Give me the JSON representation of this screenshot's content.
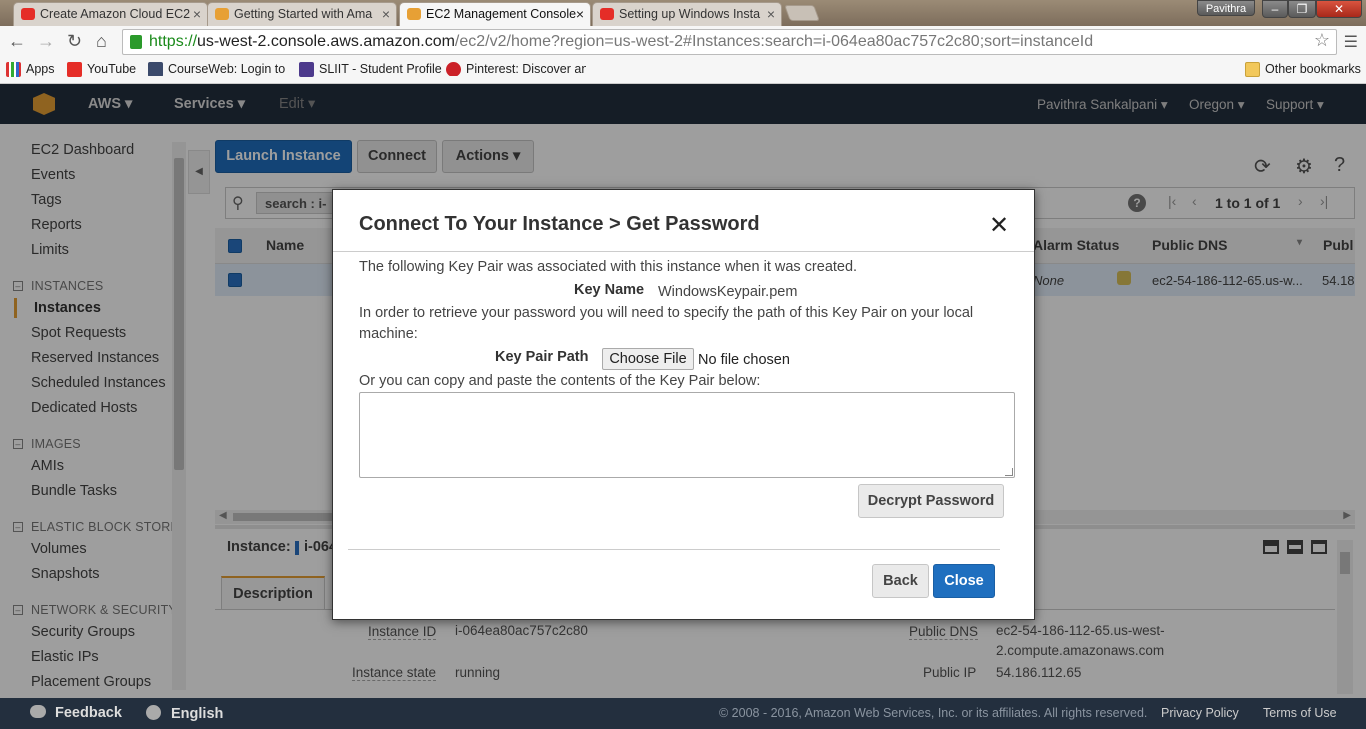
{
  "browser": {
    "tabs": [
      {
        "title": "Create Amazon Cloud EC2",
        "favicon": "youtube-red"
      },
      {
        "title": "Getting Started with Ama",
        "favicon": "aws-orange"
      },
      {
        "title": "EC2 Management Console",
        "favicon": "aws-orange"
      },
      {
        "title": "Setting up Windows Insta",
        "favicon": "youtube-red"
      }
    ],
    "user_badge": "Pavithra",
    "url": {
      "scheme": "https://",
      "host": "us-west-2.console.aws.amazon.com",
      "path": "/ec2/v2/home?region=us-west-2#Instances:search=i-064ea80ac757c2c80;sort=instanceId"
    },
    "bookmarks": [
      {
        "label": "Apps"
      },
      {
        "label": "YouTube"
      },
      {
        "label": "CourseWeb: Login to"
      },
      {
        "label": "SLIIT - Student Profile"
      },
      {
        "label": "Pinterest: Discover an"
      }
    ],
    "other_bookmarks": "Other bookmarks"
  },
  "aws_header": {
    "brand": "AWS",
    "services": "Services",
    "edit": "Edit",
    "user": "Pavithra Sankalpani",
    "region": "Oregon",
    "support": "Support"
  },
  "sidebar": {
    "top_links": [
      "EC2 Dashboard",
      "Events",
      "Tags",
      "Reports",
      "Limits"
    ],
    "sections": [
      {
        "title": "INSTANCES",
        "items": [
          "Instances",
          "Spot Requests",
          "Reserved Instances",
          "Scheduled Instances",
          "Dedicated Hosts"
        ]
      },
      {
        "title": "IMAGES",
        "items": [
          "AMIs",
          "Bundle Tasks"
        ]
      },
      {
        "title": "ELASTIC BLOCK STORE",
        "items": [
          "Volumes",
          "Snapshots"
        ]
      },
      {
        "title": "NETWORK & SECURITY",
        "items": [
          "Security Groups",
          "Elastic IPs",
          "Placement Groups"
        ]
      }
    ],
    "active_item": "Instances"
  },
  "main": {
    "launch_button": "Launch Instance",
    "connect_button": "Connect",
    "actions_button": "Actions",
    "search_token": "search",
    "search_token_value": "i-",
    "pagination": "1 to 1 of 1",
    "columns": {
      "name": "Name",
      "alarm_status": "Alarm Status",
      "public_dns": "Public DNS",
      "public_ip": "Publ"
    },
    "row": {
      "alarm_status": "None",
      "public_dns": "ec2-54-186-112-65.us-w...",
      "public_ip": "54.18"
    },
    "detail_label": "Instance:",
    "detail_value": "i-064",
    "description_tab": "Description",
    "details": {
      "instance_id_label": "Instance ID",
      "instance_id": "i-064ea80ac757c2c80",
      "instance_state_label": "Instance state",
      "instance_state": "running",
      "public_dns_label": "Public DNS",
      "public_dns_line1": "ec2-54-186-112-65.us-west-",
      "public_dns_line2": "2.compute.amazonaws.com",
      "public_ip_label": "Public IP",
      "public_ip": "54.186.112.65"
    }
  },
  "modal": {
    "title": "Connect To Your Instance > Get Password",
    "intro": "The following Key Pair was associated with this instance when it was created.",
    "key_name_label": "Key Name",
    "key_name_value": "WindowsKeypair.pem",
    "instructions": "In order to retrieve your password you will need to specify the path of this Key Pair on your local",
    "instructions_cont": "machine:",
    "key_pair_path_label": "Key Pair Path",
    "choose_file_button": "Choose File",
    "no_file_text": "No file chosen",
    "paste_text": "Or you can copy and paste the contents of the Key Pair below:",
    "textarea_value": "",
    "decrypt_button": "Decrypt Password",
    "back_button": "Back",
    "close_button": "Close"
  },
  "footer": {
    "feedback": "Feedback",
    "language": "English",
    "copyright": "© 2008 - 2016, Amazon Web Services, Inc. or its affiliates. All rights reserved.",
    "privacy": "Privacy Policy",
    "terms": "Terms of Use"
  },
  "colors": {
    "aws_navy": "#232f3e",
    "aws_orange": "#e7a035",
    "primary_blue": "#1f6fbf"
  }
}
